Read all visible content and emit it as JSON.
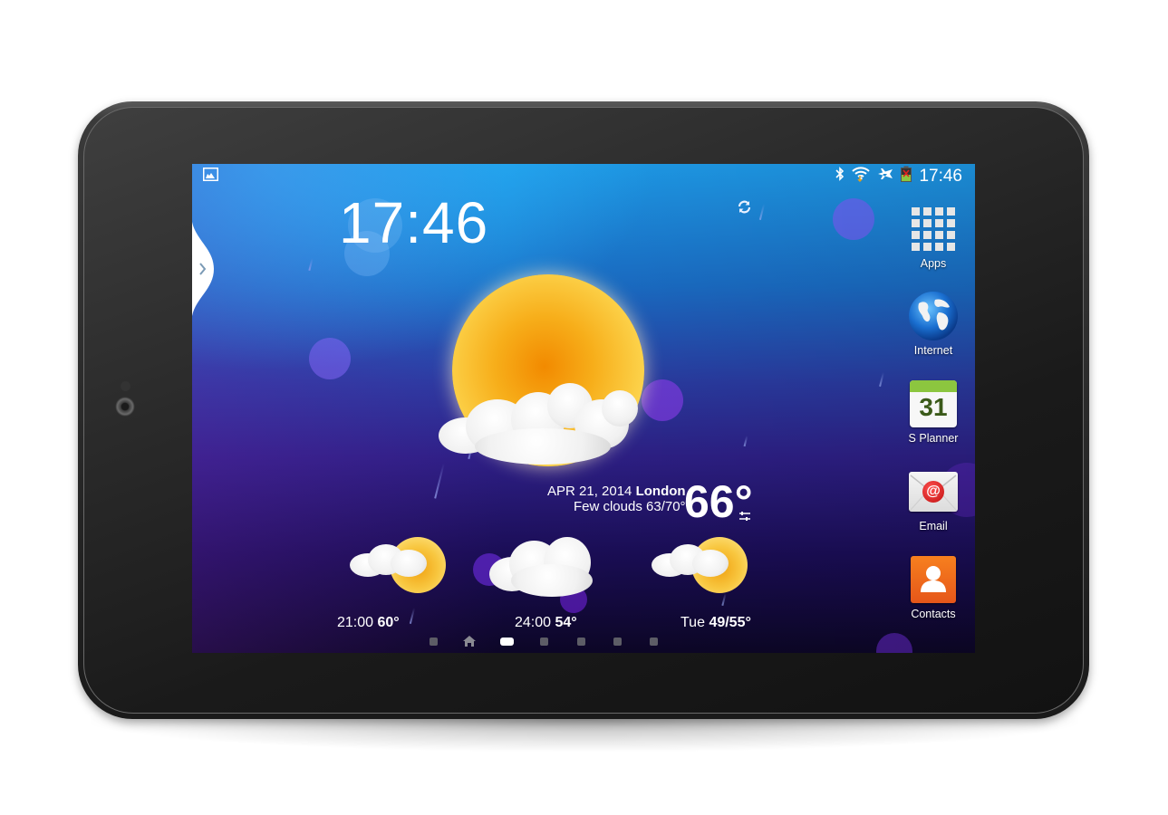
{
  "status_bar": {
    "left_icons": [
      "gallery-icon"
    ],
    "right_icons": [
      "bluetooth-icon",
      "wifi-icon",
      "airplane-mode-icon",
      "battery-icon"
    ],
    "time": "17:46"
  },
  "clock_widget": {
    "time": "17:46",
    "refresh_icon": "refresh-icon"
  },
  "weather_widget": {
    "date": "APR 21, 2014",
    "city": "London",
    "condition": "Few clouds",
    "low_high": "63/70°",
    "current_temp": "66°",
    "current_icon": "sun-with-clouds-icon",
    "settings_icon": "sliders-icon",
    "forecast": [
      {
        "label": "21:00",
        "temp": "60°",
        "icon": "partly-cloudy-rain-icon"
      },
      {
        "label": "24:00",
        "temp": "54°",
        "icon": "cloudy-icon"
      },
      {
        "label": "Tue",
        "temp": "49/55°",
        "icon": "partly-cloudy-rain-icon"
      }
    ]
  },
  "side_panel": {
    "handle_icon": "chevron-right-icon"
  },
  "dock": {
    "items": [
      {
        "label": "Apps",
        "icon": "apps-grid-icon"
      },
      {
        "label": "Internet",
        "icon": "globe-icon"
      },
      {
        "label": "S Planner",
        "icon": "calendar-icon",
        "calendar_day": "31"
      },
      {
        "label": "Email",
        "icon": "email-icon",
        "at_symbol": "@"
      },
      {
        "label": "Contacts",
        "icon": "contacts-icon"
      }
    ]
  },
  "page_indicator": {
    "pages": 7,
    "home_page_index": 1,
    "active_page_index": 2
  },
  "colors": {
    "screen_top": "#1e9ae8",
    "screen_bottom": "#0c0626",
    "calendar_green": "#8cc63f",
    "contacts_orange": "#f26522",
    "email_red": "#d21f1f"
  }
}
